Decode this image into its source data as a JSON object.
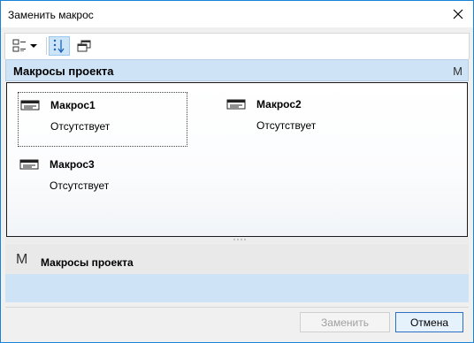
{
  "window": {
    "title": "Заменить макрос"
  },
  "toolbar": {
    "view_icon": "list-view-dropdown-icon",
    "sort_icon": "sort-order-icon",
    "copy_icon": "copy-windows-icon"
  },
  "section": {
    "title": "Макросы проекта",
    "badge": "M"
  },
  "macros": [
    {
      "name": "Макрос1",
      "status": "Отсутствует"
    },
    {
      "name": "Макрос2",
      "status": "Отсутствует"
    },
    {
      "name": "Макрос3",
      "status": "Отсутствует"
    }
  ],
  "details": {
    "badge": "M",
    "title": "Макросы проекта"
  },
  "buttons": {
    "replace": "Заменить",
    "cancel": "Отмена"
  },
  "colors": {
    "accent": "#1883d7",
    "header": "#cfe3f7"
  }
}
